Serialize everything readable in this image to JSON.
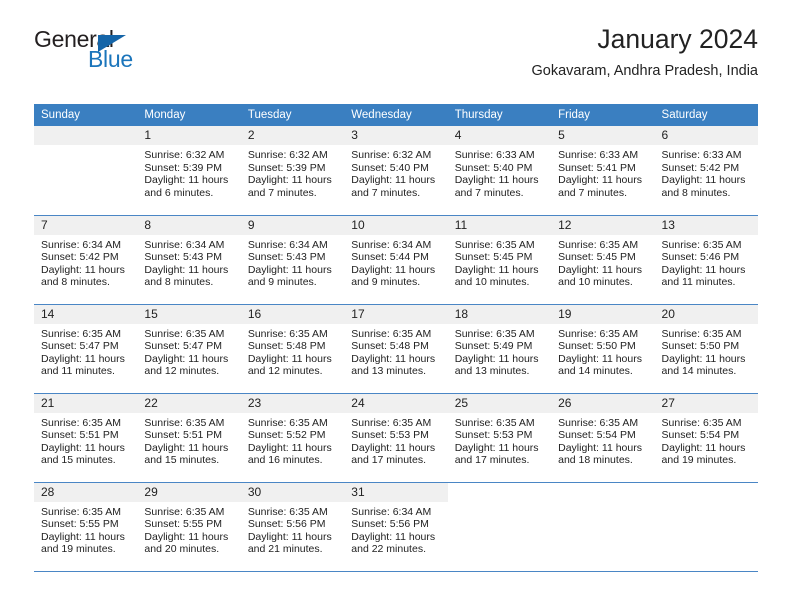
{
  "brand": {
    "name_top": "General",
    "name_bottom": "Blue",
    "triangle_color": "#1565a8",
    "blue_color": "#1b75bb"
  },
  "header": {
    "title": "January 2024",
    "location": "Gokavaram, Andhra Pradesh, India"
  },
  "theme": {
    "header_row_bg": "#3a7fc1",
    "header_row_text": "#ffffff",
    "daynum_bg": "#f0f0f0",
    "row_divider": "#4a86c5",
    "body_text": "#222222"
  },
  "columns": [
    "Sunday",
    "Monday",
    "Tuesday",
    "Wednesday",
    "Thursday",
    "Friday",
    "Saturday"
  ],
  "labels": {
    "sunrise_prefix": "Sunrise:",
    "sunset_prefix": "Sunset:",
    "daylight_prefix": "Daylight:"
  },
  "weeks": [
    [
      {
        "day": "",
        "blank": true,
        "leading": true
      },
      {
        "day": "1",
        "sunrise": "Sunrise: 6:32 AM",
        "sunset": "Sunset: 5:39 PM",
        "daylight": "Daylight: 11 hours and 6 minutes."
      },
      {
        "day": "2",
        "sunrise": "Sunrise: 6:32 AM",
        "sunset": "Sunset: 5:39 PM",
        "daylight": "Daylight: 11 hours and 7 minutes."
      },
      {
        "day": "3",
        "sunrise": "Sunrise: 6:32 AM",
        "sunset": "Sunset: 5:40 PM",
        "daylight": "Daylight: 11 hours and 7 minutes."
      },
      {
        "day": "4",
        "sunrise": "Sunrise: 6:33 AM",
        "sunset": "Sunset: 5:40 PM",
        "daylight": "Daylight: 11 hours and 7 minutes."
      },
      {
        "day": "5",
        "sunrise": "Sunrise: 6:33 AM",
        "sunset": "Sunset: 5:41 PM",
        "daylight": "Daylight: 11 hours and 7 minutes."
      },
      {
        "day": "6",
        "sunrise": "Sunrise: 6:33 AM",
        "sunset": "Sunset: 5:42 PM",
        "daylight": "Daylight: 11 hours and 8 minutes."
      }
    ],
    [
      {
        "day": "7",
        "sunrise": "Sunrise: 6:34 AM",
        "sunset": "Sunset: 5:42 PM",
        "daylight": "Daylight: 11 hours and 8 minutes."
      },
      {
        "day": "8",
        "sunrise": "Sunrise: 6:34 AM",
        "sunset": "Sunset: 5:43 PM",
        "daylight": "Daylight: 11 hours and 8 minutes."
      },
      {
        "day": "9",
        "sunrise": "Sunrise: 6:34 AM",
        "sunset": "Sunset: 5:43 PM",
        "daylight": "Daylight: 11 hours and 9 minutes."
      },
      {
        "day": "10",
        "sunrise": "Sunrise: 6:34 AM",
        "sunset": "Sunset: 5:44 PM",
        "daylight": "Daylight: 11 hours and 9 minutes."
      },
      {
        "day": "11",
        "sunrise": "Sunrise: 6:35 AM",
        "sunset": "Sunset: 5:45 PM",
        "daylight": "Daylight: 11 hours and 10 minutes."
      },
      {
        "day": "12",
        "sunrise": "Sunrise: 6:35 AM",
        "sunset": "Sunset: 5:45 PM",
        "daylight": "Daylight: 11 hours and 10 minutes."
      },
      {
        "day": "13",
        "sunrise": "Sunrise: 6:35 AM",
        "sunset": "Sunset: 5:46 PM",
        "daylight": "Daylight: 11 hours and 11 minutes."
      }
    ],
    [
      {
        "day": "14",
        "sunrise": "Sunrise: 6:35 AM",
        "sunset": "Sunset: 5:47 PM",
        "daylight": "Daylight: 11 hours and 11 minutes."
      },
      {
        "day": "15",
        "sunrise": "Sunrise: 6:35 AM",
        "sunset": "Sunset: 5:47 PM",
        "daylight": "Daylight: 11 hours and 12 minutes."
      },
      {
        "day": "16",
        "sunrise": "Sunrise: 6:35 AM",
        "sunset": "Sunset: 5:48 PM",
        "daylight": "Daylight: 11 hours and 12 minutes."
      },
      {
        "day": "17",
        "sunrise": "Sunrise: 6:35 AM",
        "sunset": "Sunset: 5:48 PM",
        "daylight": "Daylight: 11 hours and 13 minutes."
      },
      {
        "day": "18",
        "sunrise": "Sunrise: 6:35 AM",
        "sunset": "Sunset: 5:49 PM",
        "daylight": "Daylight: 11 hours and 13 minutes."
      },
      {
        "day": "19",
        "sunrise": "Sunrise: 6:35 AM",
        "sunset": "Sunset: 5:50 PM",
        "daylight": "Daylight: 11 hours and 14 minutes."
      },
      {
        "day": "20",
        "sunrise": "Sunrise: 6:35 AM",
        "sunset": "Sunset: 5:50 PM",
        "daylight": "Daylight: 11 hours and 14 minutes."
      }
    ],
    [
      {
        "day": "21",
        "sunrise": "Sunrise: 6:35 AM",
        "sunset": "Sunset: 5:51 PM",
        "daylight": "Daylight: 11 hours and 15 minutes."
      },
      {
        "day": "22",
        "sunrise": "Sunrise: 6:35 AM",
        "sunset": "Sunset: 5:51 PM",
        "daylight": "Daylight: 11 hours and 15 minutes."
      },
      {
        "day": "23",
        "sunrise": "Sunrise: 6:35 AM",
        "sunset": "Sunset: 5:52 PM",
        "daylight": "Daylight: 11 hours and 16 minutes."
      },
      {
        "day": "24",
        "sunrise": "Sunrise: 6:35 AM",
        "sunset": "Sunset: 5:53 PM",
        "daylight": "Daylight: 11 hours and 17 minutes."
      },
      {
        "day": "25",
        "sunrise": "Sunrise: 6:35 AM",
        "sunset": "Sunset: 5:53 PM",
        "daylight": "Daylight: 11 hours and 17 minutes."
      },
      {
        "day": "26",
        "sunrise": "Sunrise: 6:35 AM",
        "sunset": "Sunset: 5:54 PM",
        "daylight": "Daylight: 11 hours and 18 minutes."
      },
      {
        "day": "27",
        "sunrise": "Sunrise: 6:35 AM",
        "sunset": "Sunset: 5:54 PM",
        "daylight": "Daylight: 11 hours and 19 minutes."
      }
    ],
    [
      {
        "day": "28",
        "sunrise": "Sunrise: 6:35 AM",
        "sunset": "Sunset: 5:55 PM",
        "daylight": "Daylight: 11 hours and 19 minutes."
      },
      {
        "day": "29",
        "sunrise": "Sunrise: 6:35 AM",
        "sunset": "Sunset: 5:55 PM",
        "daylight": "Daylight: 11 hours and 20 minutes."
      },
      {
        "day": "30",
        "sunrise": "Sunrise: 6:35 AM",
        "sunset": "Sunset: 5:56 PM",
        "daylight": "Daylight: 11 hours and 21 minutes."
      },
      {
        "day": "31",
        "sunrise": "Sunrise: 6:34 AM",
        "sunset": "Sunset: 5:56 PM",
        "daylight": "Daylight: 11 hours and 22 minutes."
      },
      {
        "day": "",
        "blank": true,
        "trailing": true
      },
      {
        "day": "",
        "blank": true,
        "trailing": true
      },
      {
        "day": "",
        "blank": true,
        "trailing": true
      }
    ]
  ]
}
